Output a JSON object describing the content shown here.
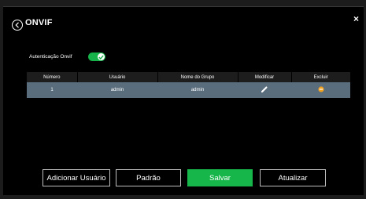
{
  "dialog": {
    "title": "ONVIF",
    "close_label": "×"
  },
  "auth": {
    "label": "Autenticação Onvif",
    "enabled": true
  },
  "table": {
    "headers": [
      "Número",
      "Usuário",
      "Nome do Grupo",
      "Modificar",
      "Excluir"
    ],
    "rows": [
      {
        "number": "1",
        "user": "admin",
        "group": "admin"
      }
    ]
  },
  "buttons": {
    "add_user": "Adicionar Usuário",
    "default": "Padrão",
    "save": "Salvar",
    "refresh": "Atualizar"
  },
  "colors": {
    "accent": "#16b64b",
    "row": "#5a6d7d",
    "delete": "#f0a020"
  },
  "icons": [
    "back-icon",
    "close-icon",
    "check-icon",
    "pencil-icon",
    "minus-circle-icon"
  ]
}
